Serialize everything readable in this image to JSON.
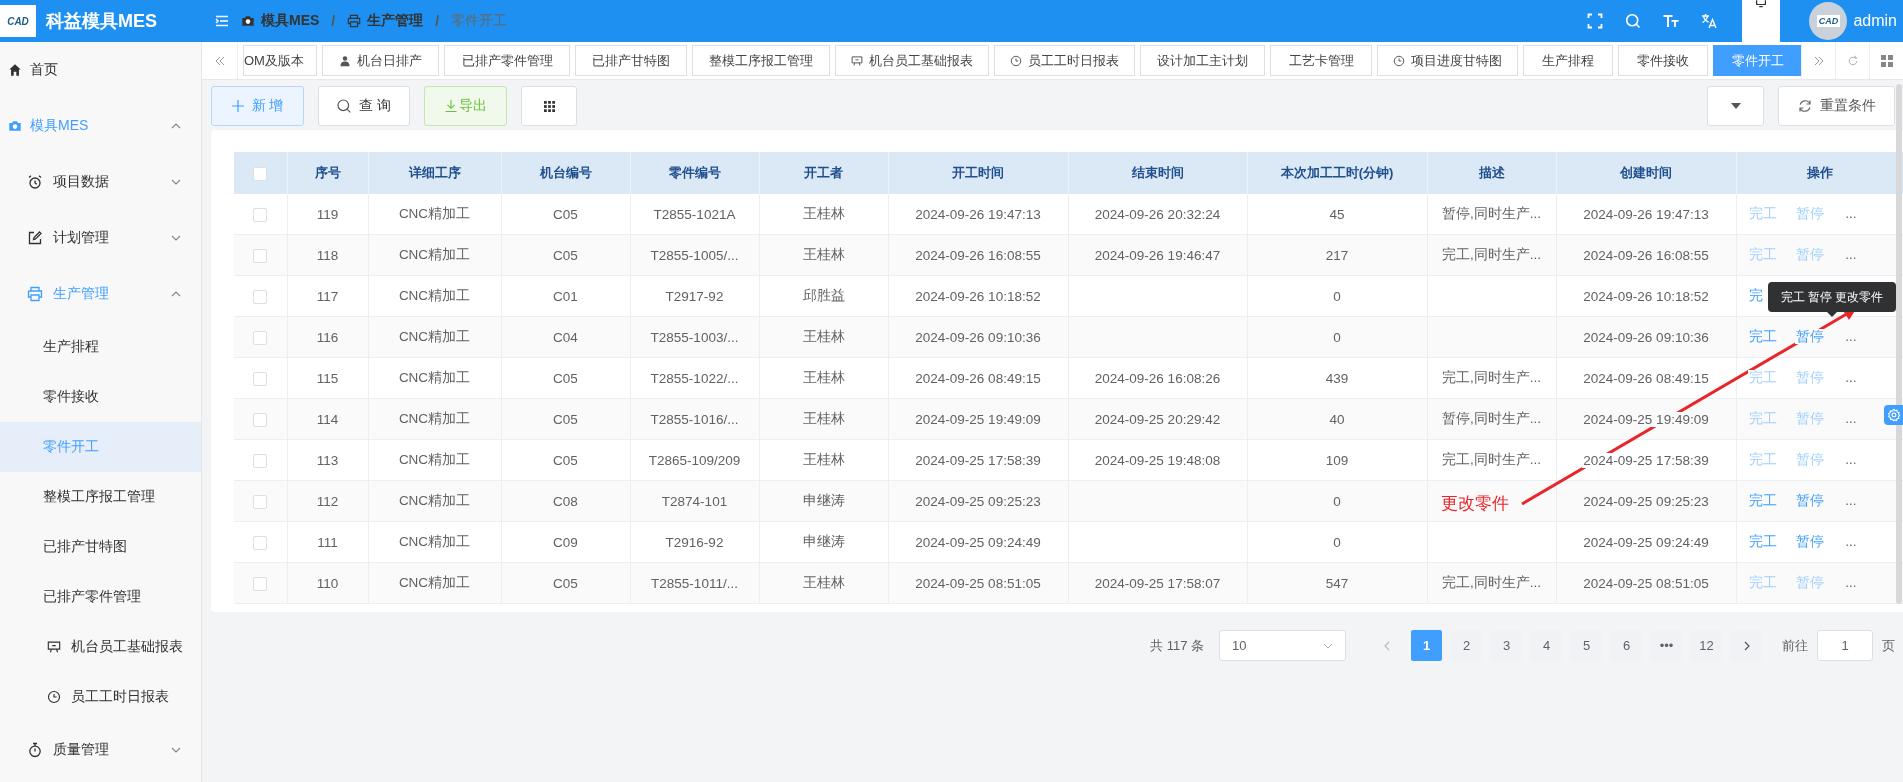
{
  "header": {
    "logo_text": "CAD",
    "title": "科益模具MES",
    "breadcrumb": [
      "模具MES",
      "生产管理",
      "零件开工"
    ],
    "breadcrumb_separators": [
      "/",
      "/"
    ],
    "user": {
      "avatar_text": "CAD",
      "name": "admin"
    }
  },
  "sidebar": {
    "items": [
      {
        "label": "首页",
        "selected": false
      },
      {
        "label": "模具MES",
        "selected": false,
        "expanded": true,
        "children": [
          {
            "label": "项目数据",
            "selected": false,
            "expanded": false
          },
          {
            "label": "计划管理",
            "selected": false,
            "expanded": false
          },
          {
            "label": "生产管理",
            "selected": false,
            "expanded": true,
            "children": [
              {
                "label": "生产排程",
                "selected": false
              },
              {
                "label": "零件接收",
                "selected": false
              },
              {
                "label": "零件开工",
                "selected": true
              },
              {
                "label": "整模工序报工管理",
                "selected": false
              },
              {
                "label": "已排产甘特图",
                "selected": false
              },
              {
                "label": "已排产零件管理",
                "selected": false
              },
              {
                "label": "机台员工基础报表",
                "selected": false
              },
              {
                "label": "员工工时日报表",
                "selected": false
              }
            ]
          },
          {
            "label": "质量管理",
            "selected": false,
            "expanded": false
          }
        ]
      }
    ]
  },
  "tabs": [
    {
      "label": "OM及版本",
      "selected": false
    },
    {
      "label": "机台日排产",
      "selected": false
    },
    {
      "label": "已排产零件管理",
      "selected": false
    },
    {
      "label": "已排产甘特图",
      "selected": false
    },
    {
      "label": "整模工序报工管理",
      "selected": false
    },
    {
      "label": "机台员工基础报表",
      "selected": false
    },
    {
      "label": "员工工时日报表",
      "selected": false
    },
    {
      "label": "设计加工主计划",
      "selected": false
    },
    {
      "label": "工艺卡管理",
      "selected": false
    },
    {
      "label": "项目进度甘特图",
      "selected": false
    },
    {
      "label": "生产排程",
      "selected": false
    },
    {
      "label": "零件接收",
      "selected": false
    },
    {
      "label": "零件开工",
      "selected": true
    }
  ],
  "toolbar": {
    "add": "新 增",
    "query": "查 询",
    "export": "导出",
    "reset": "重置条件"
  },
  "table": {
    "select_all_checked": false,
    "columns": [
      "序号",
      "详细工序",
      "机台编号",
      "零件编号",
      "开工者",
      "开工时间",
      "结束时间",
      "本次加工工时(分钟)",
      "描述",
      "创建时间",
      "操作"
    ],
    "rows": [
      {
        "no": "119",
        "process": "CNC精加工",
        "machine": "C05",
        "part": "T2855-1021A",
        "operator": "王桂林",
        "start": "2024-09-26 19:47:13",
        "end": "2024-09-26 20:32:24",
        "minutes": "45",
        "desc": "暂停,同时生产...",
        "created": "2024-09-26 19:47:13",
        "checked": false,
        "actions_enabled": false,
        "actions": [
          "完工",
          "暂停"
        ],
        "more": "..."
      },
      {
        "no": "118",
        "process": "CNC精加工",
        "machine": "C05",
        "part": "T2855-1005/...",
        "operator": "王桂林",
        "start": "2024-09-26 16:08:55",
        "end": "2024-09-26 19:46:47",
        "minutes": "217",
        "desc": "完工,同时生产...",
        "created": "2024-09-26 16:08:55",
        "checked": false,
        "actions_enabled": false,
        "actions": [
          "完工",
          "暂停"
        ],
        "more": "..."
      },
      {
        "no": "117",
        "process": "CNC精加工",
        "machine": "C01",
        "part": "T2917-92",
        "operator": "邱胜益",
        "start": "2024-09-26 10:18:52",
        "minutes": "0",
        "created": "2024-09-26 10:18:52",
        "checked": false,
        "actions_enabled": true,
        "actions": [
          "完"
        ]
      },
      {
        "no": "116",
        "process": "CNC精加工",
        "machine": "C04",
        "part": "T2855-1003/...",
        "operator": "王桂林",
        "start": "2024-09-26 09:10:36",
        "minutes": "0",
        "created": "2024-09-26 09:10:36",
        "checked": false,
        "actions_enabled": true,
        "actions": [
          "完工",
          "暂停"
        ],
        "more": "..."
      },
      {
        "no": "115",
        "process": "CNC精加工",
        "machine": "C05",
        "part": "T2855-1022/...",
        "operator": "王桂林",
        "start": "2024-09-26 08:49:15",
        "end": "2024-09-26 16:08:26",
        "minutes": "439",
        "desc": "完工,同时生产...",
        "created": "2024-09-26 08:49:15",
        "checked": false,
        "actions_enabled": false,
        "actions": [
          "完工",
          "暂停"
        ],
        "more": "..."
      },
      {
        "no": "114",
        "process": "CNC精加工",
        "machine": "C05",
        "part": "T2855-1016/...",
        "operator": "王桂林",
        "start": "2024-09-25 19:49:09",
        "end": "2024-09-25 20:29:42",
        "minutes": "40",
        "desc": "暂停,同时生产...",
        "created": "2024-09-25 19:49:09",
        "checked": false,
        "actions_enabled": false,
        "actions": [
          "完工",
          "暂停"
        ],
        "more": "..."
      },
      {
        "no": "113",
        "process": "CNC精加工",
        "machine": "C05",
        "part": "T2865-109/209",
        "operator": "王桂林",
        "start": "2024-09-25 17:58:39",
        "end": "2024-09-25 19:48:08",
        "minutes": "109",
        "desc": "完工,同时生产...",
        "created": "2024-09-25 17:58:39",
        "checked": false,
        "actions_enabled": false,
        "actions": [
          "完工",
          "暂停"
        ],
        "more": "..."
      },
      {
        "no": "112",
        "process": "CNC精加工",
        "machine": "C08",
        "part": "T2874-101",
        "operator": "申继涛",
        "start": "2024-09-25 09:25:23",
        "minutes": "0",
        "created": "2024-09-25 09:25:23",
        "checked": false,
        "actions_enabled": true,
        "actions": [
          "完工",
          "暂停"
        ],
        "more": "..."
      },
      {
        "no": "111",
        "process": "CNC精加工",
        "machine": "C09",
        "part": "T2916-92",
        "operator": "申继涛",
        "start": "2024-09-25 09:24:49",
        "minutes": "0",
        "created": "2024-09-25 09:24:49",
        "checked": false,
        "actions_enabled": true,
        "actions": [
          "完工",
          "暂停"
        ],
        "more": "..."
      },
      {
        "no": "110",
        "process": "CNC精加工",
        "machine": "C05",
        "part": "T2855-1011/...",
        "operator": "王桂林",
        "start": "2024-09-25 08:51:05",
        "end": "2024-09-25 17:58:07",
        "minutes": "547",
        "desc": "完工,同时生产...",
        "created": "2024-09-25 08:51:05",
        "checked": false,
        "actions_enabled": false,
        "actions": [
          "完工",
          "暂停"
        ],
        "more": "..."
      }
    ]
  },
  "tooltip": {
    "text": "完工 暂停 更改零件"
  },
  "annotation": {
    "text": "更改零件"
  },
  "pagination": {
    "total": "共 117 条",
    "page_size": "10",
    "pages": [
      {
        "label": "1",
        "selected": true
      },
      {
        "label": "2",
        "selected": false
      },
      {
        "label": "3",
        "selected": false
      },
      {
        "label": "4",
        "selected": false
      },
      {
        "label": "5",
        "selected": false
      },
      {
        "label": "6",
        "selected": false
      },
      {
        "label": "•••",
        "selected": false
      },
      {
        "label": "12",
        "selected": false
      }
    ],
    "goto_label": "前往",
    "goto_value": "1",
    "goto_suffix": "页"
  }
}
